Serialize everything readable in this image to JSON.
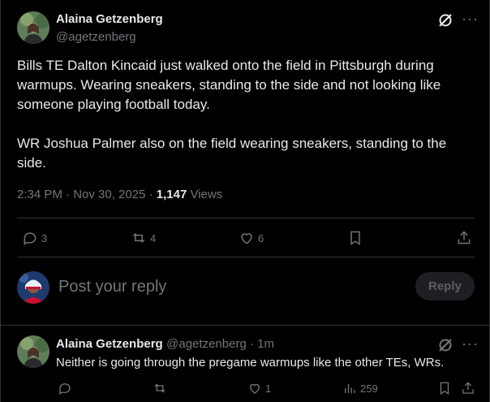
{
  "tweet": {
    "author_name": "Alaina Getzenberg",
    "author_handle": "@agetzenberg",
    "text": "Bills TE Dalton Kincaid just walked onto the field in Pittsburgh during warmups. Wearing sneakers, standing to the side and not looking like someone playing football today.\n\nWR Joshua Palmer also on the field wearing sneakers, standing to the side.",
    "time": "2:34 PM · Nov 30, 2025 · ",
    "views_count": "1,147",
    "views_label": " Views",
    "replies": "3",
    "reposts": "4",
    "likes": "6"
  },
  "composer": {
    "placeholder": "Post your reply",
    "reply_button": "Reply"
  },
  "reply": {
    "author_name": "Alaina Getzenberg",
    "author_handle": "@agetzenberg · 1m",
    "text": "Neither is going through the pregame warmups like the other TEs, WRs.",
    "likes": "1",
    "views": "259"
  },
  "icons": {
    "more": "more-icon",
    "grok": "grok-icon",
    "reply": "reply-icon",
    "repost": "repost-icon",
    "like": "like-icon",
    "bookmark": "bookmark-icon",
    "share": "share-icon",
    "views": "views-icon"
  },
  "colors": {
    "background": "#000000",
    "text": "#e7e9ea",
    "muted": "#71767b",
    "divider": "#2f3336"
  }
}
